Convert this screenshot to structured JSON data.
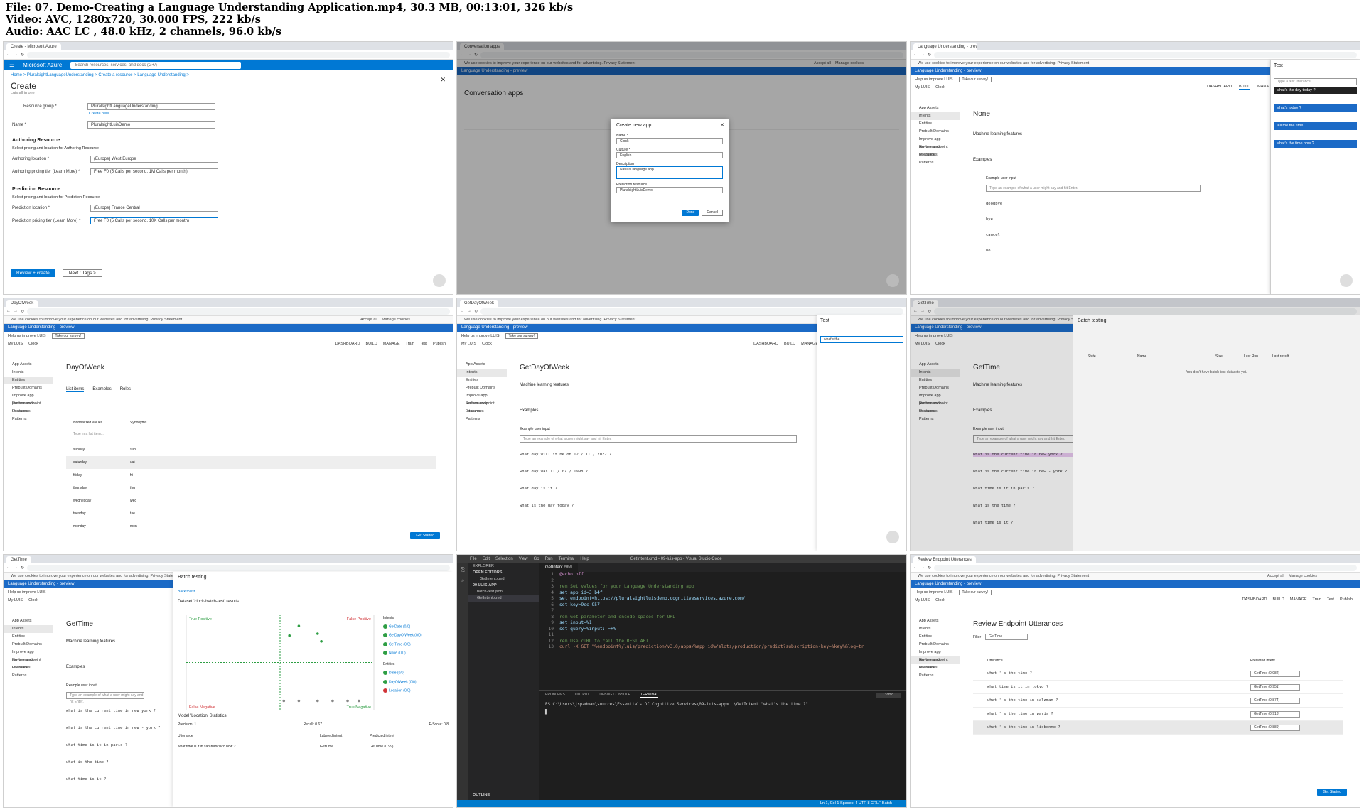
{
  "header": {
    "line1": "File: 07. Demo-Creating a Language Understanding Application.mp4, 30.3 MB, 00:13:01, 326 kb/s",
    "line2": "Video: AVC, 1280x720, 30.000 FPS, 222 kb/s",
    "line3": "Audio: AAC LC , 48.0 kHz, 2 channels, 96.0 kb/s"
  },
  "common": {
    "cookie_text": "We use cookies to improve your experience on our websites and for advertising. Privacy Statement",
    "accept_all": "Accept all",
    "manage_cookies": "Manage cookies",
    "luis_title": "Language Understanding - preview",
    "help_improve": "Help us improve LUIS",
    "take_survey": "Take our survey!",
    "my_apps": "My LUIS",
    "app_name": "Clock",
    "dashboard": "DASHBOARD",
    "build": "BUILD",
    "manage": "MANAGE",
    "train": "Train",
    "test": "Test",
    "publish": "Publish",
    "nav": [
      "App Assets",
      "Intents",
      "Entities",
      "Prebuilt Domains",
      "Improve app performance",
      "Review endpoint utterances",
      "Features",
      "Patterns"
    ],
    "ml_features": "Machine learning features",
    "examples": "Examples",
    "example_user_input": "Example user input",
    "type_example": "Type an example of what a user might say and hit Enter."
  },
  "cell1": {
    "tab": "Create - Microsoft Azure",
    "brand": "Microsoft Azure",
    "search_placeholder": "Search resources, services, and docs (G+/)",
    "breadcrumb": "Home > PluralsightLanguageUnderstanding > Create a resource > Language Understanding >",
    "title": "Create",
    "subtitle": "Luis all in one",
    "resource_group_label": "Resource group *",
    "resource_group_value": "PluralsightLanguageUnderstanding",
    "create_new": "Create new",
    "name_label": "Name *",
    "name_value": "PluralsightLuisDemo",
    "authoring_heading": "Authoring Resource",
    "authoring_desc": "Select pricing and location for Authoring Resource",
    "authoring_location_label": "Authoring location *",
    "authoring_location_value": "(Europe) West Europe",
    "authoring_tier_label": "Authoring pricing tier (Learn More) *",
    "authoring_tier_value": "Free F0 (5 Calls per second, 1M Calls per month)",
    "prediction_heading": "Prediction Resource",
    "prediction_desc": "Select pricing and location for Prediction Resource",
    "prediction_location_label": "Prediction location *",
    "prediction_location_value": "(Europe) France Central",
    "prediction_tier_label": "Prediction pricing tier (Learn More) *",
    "prediction_tier_value": "Free F0 (5 Calls per second, 10K Calls per month)",
    "review_create": "Review + create",
    "next_tags": "Next : Tags >"
  },
  "cell2": {
    "tab": "Conversation apps",
    "heading": "Conversation apps",
    "dialog_title": "Create new app",
    "name_label": "Name *",
    "name_value": "Clock",
    "culture_label": "Culture *",
    "culture_value": "English",
    "description_label": "Description",
    "description_value": "Natural language app",
    "prediction_label": "Prediction resource",
    "prediction_value": "PluralsightLuisDemo",
    "done": "Done",
    "cancel": "Cancel"
  },
  "cell3": {
    "intent": "None",
    "test_title": "Test",
    "test_placeholder": "Type a test utterance",
    "test_items": [
      "what's the day today ?",
      "what's today ?",
      "tell me the time",
      "what's the time now ?"
    ],
    "utterances": [
      "goodbye",
      "bye",
      "cancel",
      "no"
    ]
  },
  "cell4": {
    "entity": "DayOfWeek",
    "subtabs": [
      "List items",
      "Examples",
      "Roles"
    ],
    "col_normalized": "Normalized values",
    "col_synonyms": "Synonyms",
    "type_value": "Type in a list item...",
    "rows": [
      [
        "sunday",
        "sun"
      ],
      [
        "saturday",
        "sat"
      ],
      [
        "friday",
        "fri"
      ],
      [
        "thursday",
        "thu"
      ],
      [
        "wednesday",
        "wed"
      ],
      [
        "tuesday",
        "tue"
      ],
      [
        "monday",
        "mon"
      ]
    ],
    "get_started": "Get Started"
  },
  "cell5": {
    "intent": "GetDayOfWeek",
    "test_title": "Test",
    "test_value": "what's the",
    "utterances": [
      "what day will it be on 12 / 11 / 2022 ?",
      "what day was 11 / 07 / 1998 ?",
      "what day is it ?",
      "what is the day today ?"
    ]
  },
  "cell6": {
    "intent": "GetTime",
    "batch_title": "Batch testing",
    "col_name": "Name",
    "col_state": "State",
    "col_size": "Size",
    "col_last_run": "Last Run",
    "col_last_result": "Last result",
    "empty": "You don't have batch test datasets yet.",
    "utterances": [
      "what is the current time in new york ?",
      "what is the current time in new - york ?",
      "what time is it in paris ?",
      "what is the time ?",
      "what time is it ?"
    ]
  },
  "cell7": {
    "intent": "GetTime",
    "batch_title": "Batch testing",
    "back": "Back to list",
    "dataset_title": "Dataset 'clock-batch-test' results",
    "true_positive": "True Positive",
    "false_positive": "False Positive",
    "false_negative": "False Negative",
    "true_negative": "True Negative",
    "intents_label": "Intents",
    "intents": [
      "GetDate (0/0)",
      "GetDayOfWeek (0/0)",
      "GetTime (0/0)",
      "None (0/0)"
    ],
    "entities_label": "Entities",
    "entities": [
      "Date (0/0)",
      "DayOfWeek (0/0)",
      "Location (0/0)"
    ],
    "stats_title": "Model 'Location' Statistics",
    "precision": "Precision: 1",
    "recall": "Recall: 0.67",
    "fscore": "F-Score: 0.8",
    "col_utterance": "Utterance",
    "col_labeled": "Labeled intent",
    "col_predicted": "Predicted intent",
    "row_utterance": "what time is it in san-francisco now ?",
    "row_labeled": "GetTime",
    "row_predicted": "GetTime (0.99)",
    "utterances": [
      "what is the current time in new york ?",
      "what is the current time in new - york ?",
      "what time is it in paris ?",
      "what is the time ?",
      "what time is it ?"
    ],
    "chart_data": {
      "type": "scatter",
      "quadrants": [
        "True Positive",
        "False Positive",
        "False Negative",
        "True Negative"
      ],
      "series": [
        {
          "name": "True Positive",
          "points": [
            [
              0.6,
              0.88
            ],
            [
              0.7,
              0.8
            ],
            [
              0.55,
              0.78
            ],
            [
              0.72,
              0.72
            ]
          ]
        },
        {
          "name": "True Negative",
          "points": [
            [
              0.6,
              0.1
            ],
            [
              0.7,
              0.1
            ],
            [
              0.78,
              0.1
            ],
            [
              0.86,
              0.1
            ],
            [
              0.92,
              0.1
            ]
          ]
        },
        {
          "name": "False Negative",
          "points": [
            [
              0.52,
              0.1
            ]
          ]
        }
      ]
    }
  },
  "cell8": {
    "title": "GetIntent.cmd - 09-luis-app - Visual Studio Code",
    "menu": [
      "File",
      "Edit",
      "Selection",
      "View",
      "Go",
      "Run",
      "Terminal",
      "Help"
    ],
    "explorer": "EXPLORER",
    "open_editors": "OPEN EDITORS",
    "open_file": "GetIntent.cmd",
    "folder": "09-LUIS-APP",
    "files": [
      "batch-test.json",
      "GetIntent.cmd"
    ],
    "outline": "OUTLINE",
    "tab": "GetIntent.cmd",
    "code": [
      {
        "n": "1",
        "t": "@echo off",
        "c": "kw"
      },
      {
        "n": "2",
        "t": "",
        "c": ""
      },
      {
        "n": "3",
        "t": "rem Set values for your Language Understanding app",
        "c": "cm"
      },
      {
        "n": "4",
        "t": "set app_id=3                         b4f",
        "c": "var"
      },
      {
        "n": "5",
        "t": "set endpoint=https://pluralsightluisdemo.cognitiveservices.azure.com/",
        "c": "var"
      },
      {
        "n": "6",
        "t": "set key=9cc                      957",
        "c": "var"
      },
      {
        "n": "7",
        "t": "",
        "c": ""
      },
      {
        "n": "8",
        "t": "rem Get parameter and encode spaces for URL",
        "c": "cm"
      },
      {
        "n": "9",
        "t": "set input=%1",
        "c": "var"
      },
      {
        "n": "10",
        "t": "set query=%input: =+%",
        "c": "var"
      },
      {
        "n": "11",
        "t": "",
        "c": ""
      },
      {
        "n": "12",
        "t": "rem Use cURL to call the REST API",
        "c": "cm"
      },
      {
        "n": "13",
        "t": "curl -X GET \"%endpoint%/luis/prediction/v3.0/apps/%app_id%/slots/production/predict?subscription-key=%key%&log=tr",
        "c": "str"
      }
    ],
    "panel_tabs": [
      "PROBLEMS",
      "OUTPUT",
      "DEBUG CONSOLE",
      "TERMINAL"
    ],
    "terminal_select": "1: cmd",
    "prompt": "PS C:\\Users\\jspadman\\sources\\Essentials Of Cognitive Services\\09-luis-app> .\\GetIntent \"what's the time ?\"",
    "status": "Ln 1, Col 1    Spaces: 4    UTF-8    CRLF    Batch"
  },
  "cell9": {
    "title": "Review Endpoint Utterances",
    "filter_label": "Filter",
    "filter_value": "GetTime",
    "col_utterance": "Utterance",
    "col_predicted": "Predicted intent",
    "rows": [
      {
        "u": "what ' s the time ?",
        "p": "GetTime (0.982)"
      },
      {
        "u": "what time is it in tokyo ?",
        "p": "GetTime (0.951)"
      },
      {
        "u": "what ' s the time in salzman ?",
        "p": "GetTime (0.874)"
      },
      {
        "u": "what ' s the time in paris ?",
        "p": "GetTime (0.916)"
      },
      {
        "u": "what ' s the time in lisbonne ?",
        "p": "GetTime (0.889)"
      }
    ],
    "get_started": "Get Started"
  }
}
